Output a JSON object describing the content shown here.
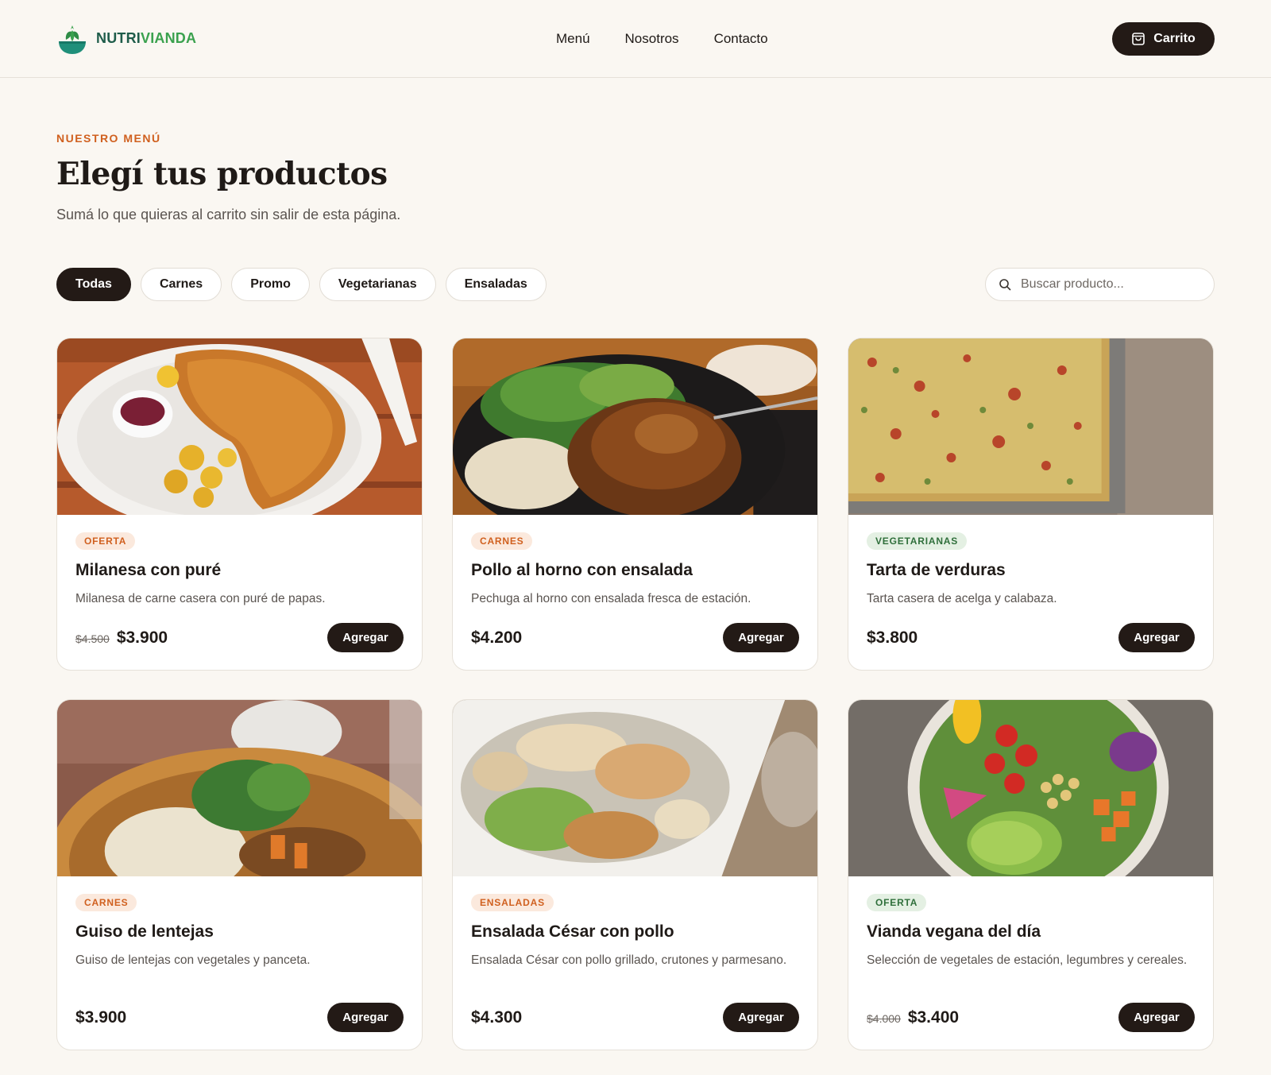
{
  "header": {
    "brand_a": "NUTRI",
    "brand_b": "VIANDA",
    "nav": [
      "Menú",
      "Nosotros",
      "Contacto"
    ],
    "cart_label": "Carrito"
  },
  "intro": {
    "kicker": "NUESTRO MENÚ",
    "title": "Elegí tus productos",
    "subtitle": "Sumá lo que quieras al carrito sin salir de esta página."
  },
  "filters": {
    "chips": [
      "Todas",
      "Carnes",
      "Promo",
      "Vegetarianas",
      "Ensaladas"
    ],
    "active": "Todas"
  },
  "search": {
    "placeholder": "Buscar producto..."
  },
  "products": [
    {
      "badge": "OFERTA",
      "badge_color": "orange",
      "name": "Milanesa con puré",
      "desc": "Milanesa de carne casera con puré de papas.",
      "old_price": "$4.500",
      "price": "$3.900",
      "button": "Agregar",
      "image": "milanesa-photo"
    },
    {
      "badge": "CARNES",
      "badge_color": "orange",
      "name": "Pollo al horno con ensalada",
      "desc": "Pechuga al horno con ensalada fresca de estación.",
      "old_price": "",
      "price": "$4.200",
      "button": "Agregar",
      "image": "pollo-photo"
    },
    {
      "badge": "VEGETARIANAS",
      "badge_color": "green",
      "name": "Tarta de verduras",
      "desc": "Tarta casera de acelga y calabaza.",
      "old_price": "",
      "price": "$3.800",
      "button": "Agregar",
      "image": "tarta-photo"
    },
    {
      "badge": "CARNES",
      "badge_color": "orange",
      "name": "Guiso de lentejas",
      "desc": "Guiso de lentejas con vegetales y panceta.",
      "old_price": "",
      "price": "$3.900",
      "button": "Agregar",
      "image": "guiso-photo"
    },
    {
      "badge": "ENSALADAS",
      "badge_color": "orange",
      "name": "Ensalada César con pollo",
      "desc": "Ensalada César con pollo grillado, crutones y parmesano.",
      "old_price": "",
      "price": "$4.300",
      "button": "Agregar",
      "image": "cesar-photo"
    },
    {
      "badge": "OFERTA",
      "badge_color": "green",
      "name": "Vianda vegana del día",
      "desc": "Selección de vegetales de estación, legumbres y cereales.",
      "old_price": "$4.000",
      "price": "$3.400",
      "button": "Agregar",
      "image": "vegana-photo"
    }
  ],
  "colors": {
    "accent": "#d0601f",
    "dark": "#231a16",
    "brand_dark": "#1e5c4a",
    "brand_green": "#3aa14e",
    "background": "#faf7f2"
  }
}
